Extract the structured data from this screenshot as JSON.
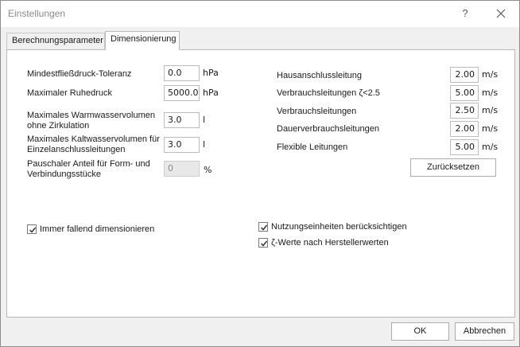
{
  "window": {
    "title": "Einstellungen",
    "help_label": "?",
    "close_icon": "close-icon"
  },
  "tabs": [
    {
      "label": "Berechnungsparameter",
      "active": false
    },
    {
      "label": "Dimensionierung",
      "active": true
    }
  ],
  "left_fields": {
    "min_pressure": {
      "label": "Mindestfließdruck-Toleranz",
      "value": "0.0",
      "unit": "hPa"
    },
    "rest_pressure": {
      "label": "Maximaler Ruhedruck",
      "value": "5000.0",
      "unit": "hPa"
    },
    "warm_volume": {
      "label_line1": "Maximales Warmwasservolumen",
      "label_line2": "ohne Zirkulation",
      "value": "3.0",
      "unit": "l"
    },
    "cold_volume": {
      "label_line1": "Maximales Kaltwasservolumen für",
      "label_line2": "Einzelanschlussleitungen",
      "value": "3.0",
      "unit": "l"
    },
    "fittings_share": {
      "label_line1": "Pauschaler Anteil für Form- und",
      "label_line2": "Verbindungsstücke",
      "value": "0",
      "unit": "%"
    }
  },
  "right_fields": [
    {
      "label": "Hausanschlussleitung",
      "value": "2.00",
      "unit": "m/s"
    },
    {
      "label": "Verbrauchsleitungen ζ<2.5",
      "value": "5.00",
      "unit": "m/s"
    },
    {
      "label": "Verbrauchsleitungen",
      "value": "2.50",
      "unit": "m/s"
    },
    {
      "label": "Dauerverbrauchsleitungen",
      "value": "2.00",
      "unit": "m/s"
    },
    {
      "label": "Flexible Leitungen",
      "value": "5.00",
      "unit": "m/s"
    }
  ],
  "reset_label": "Zurücksetzen",
  "checkboxes": {
    "falling": {
      "label": "Immer fallend dimensionieren",
      "checked": true
    },
    "usage_units": {
      "label": "Nutzungseinheiten berücksichtigen",
      "checked": true
    },
    "zeta_values": {
      "label": "ζ-Werte nach Herstellerwerten",
      "checked": true
    }
  },
  "footer": {
    "ok_label": "OK",
    "cancel_label": "Abbrechen"
  }
}
